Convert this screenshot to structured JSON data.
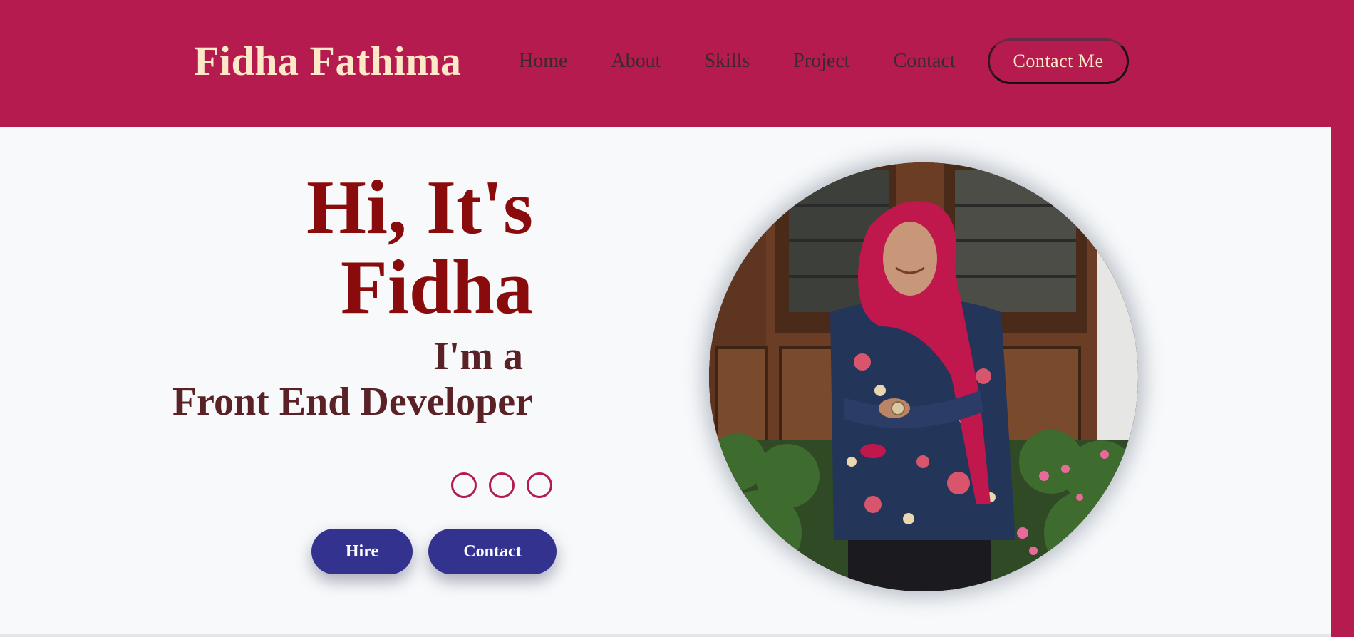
{
  "header": {
    "brand": "Fidha Fathima",
    "nav": [
      {
        "label": "Home"
      },
      {
        "label": "About"
      },
      {
        "label": "Skills"
      },
      {
        "label": "Project"
      },
      {
        "label": "Contact"
      }
    ],
    "cta_label": "Contact Me"
  },
  "hero": {
    "greeting_line1": "Hi, It's",
    "greeting_line2": "Fidha",
    "role_prefix": "I'm a",
    "role": "Front End Developer",
    "social_icons": [
      "social-icon-1",
      "social-icon-2",
      "social-icon-3"
    ],
    "buttons": {
      "hire": "Hire",
      "contact": "Contact"
    },
    "portrait_icon": "profile-photo"
  },
  "colors": {
    "brand_crimson": "#b51b4e",
    "brand_text": "#fde8c8",
    "headline": "#8a0b0b",
    "subheadline": "#5a2227",
    "button_blue": "#33338f",
    "background": "#f7f9fb"
  }
}
